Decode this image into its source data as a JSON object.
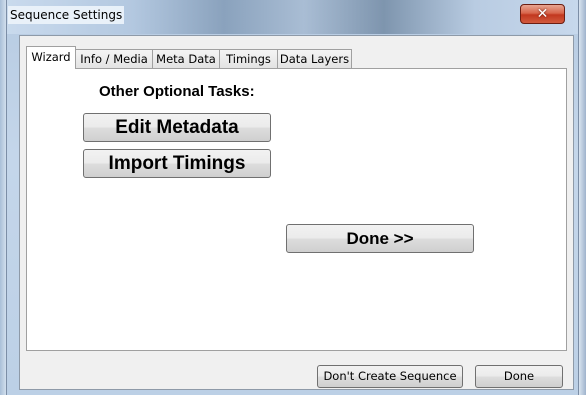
{
  "window": {
    "title": "Sequence Settings",
    "close_symbol": "✕",
    "close_icon": "close-icon"
  },
  "tabs": [
    {
      "label": "Wizard",
      "active": true
    },
    {
      "label": "Info / Media",
      "active": false
    },
    {
      "label": "Meta Data",
      "active": false
    },
    {
      "label": "Timings",
      "active": false
    },
    {
      "label": "Data Layers",
      "active": false
    }
  ],
  "wizard": {
    "heading": "Other Optional Tasks:",
    "edit_metadata_label": "Edit Metadata",
    "import_timings_label": "Import Timings",
    "done_label": "Done >>"
  },
  "footer": {
    "dont_create_label": "Don't Create Sequence",
    "done_label": "Done"
  },
  "colors": {
    "close_button": "#c2381f",
    "panel_background": "#ffffff",
    "client_background": "#f0f0f0"
  }
}
